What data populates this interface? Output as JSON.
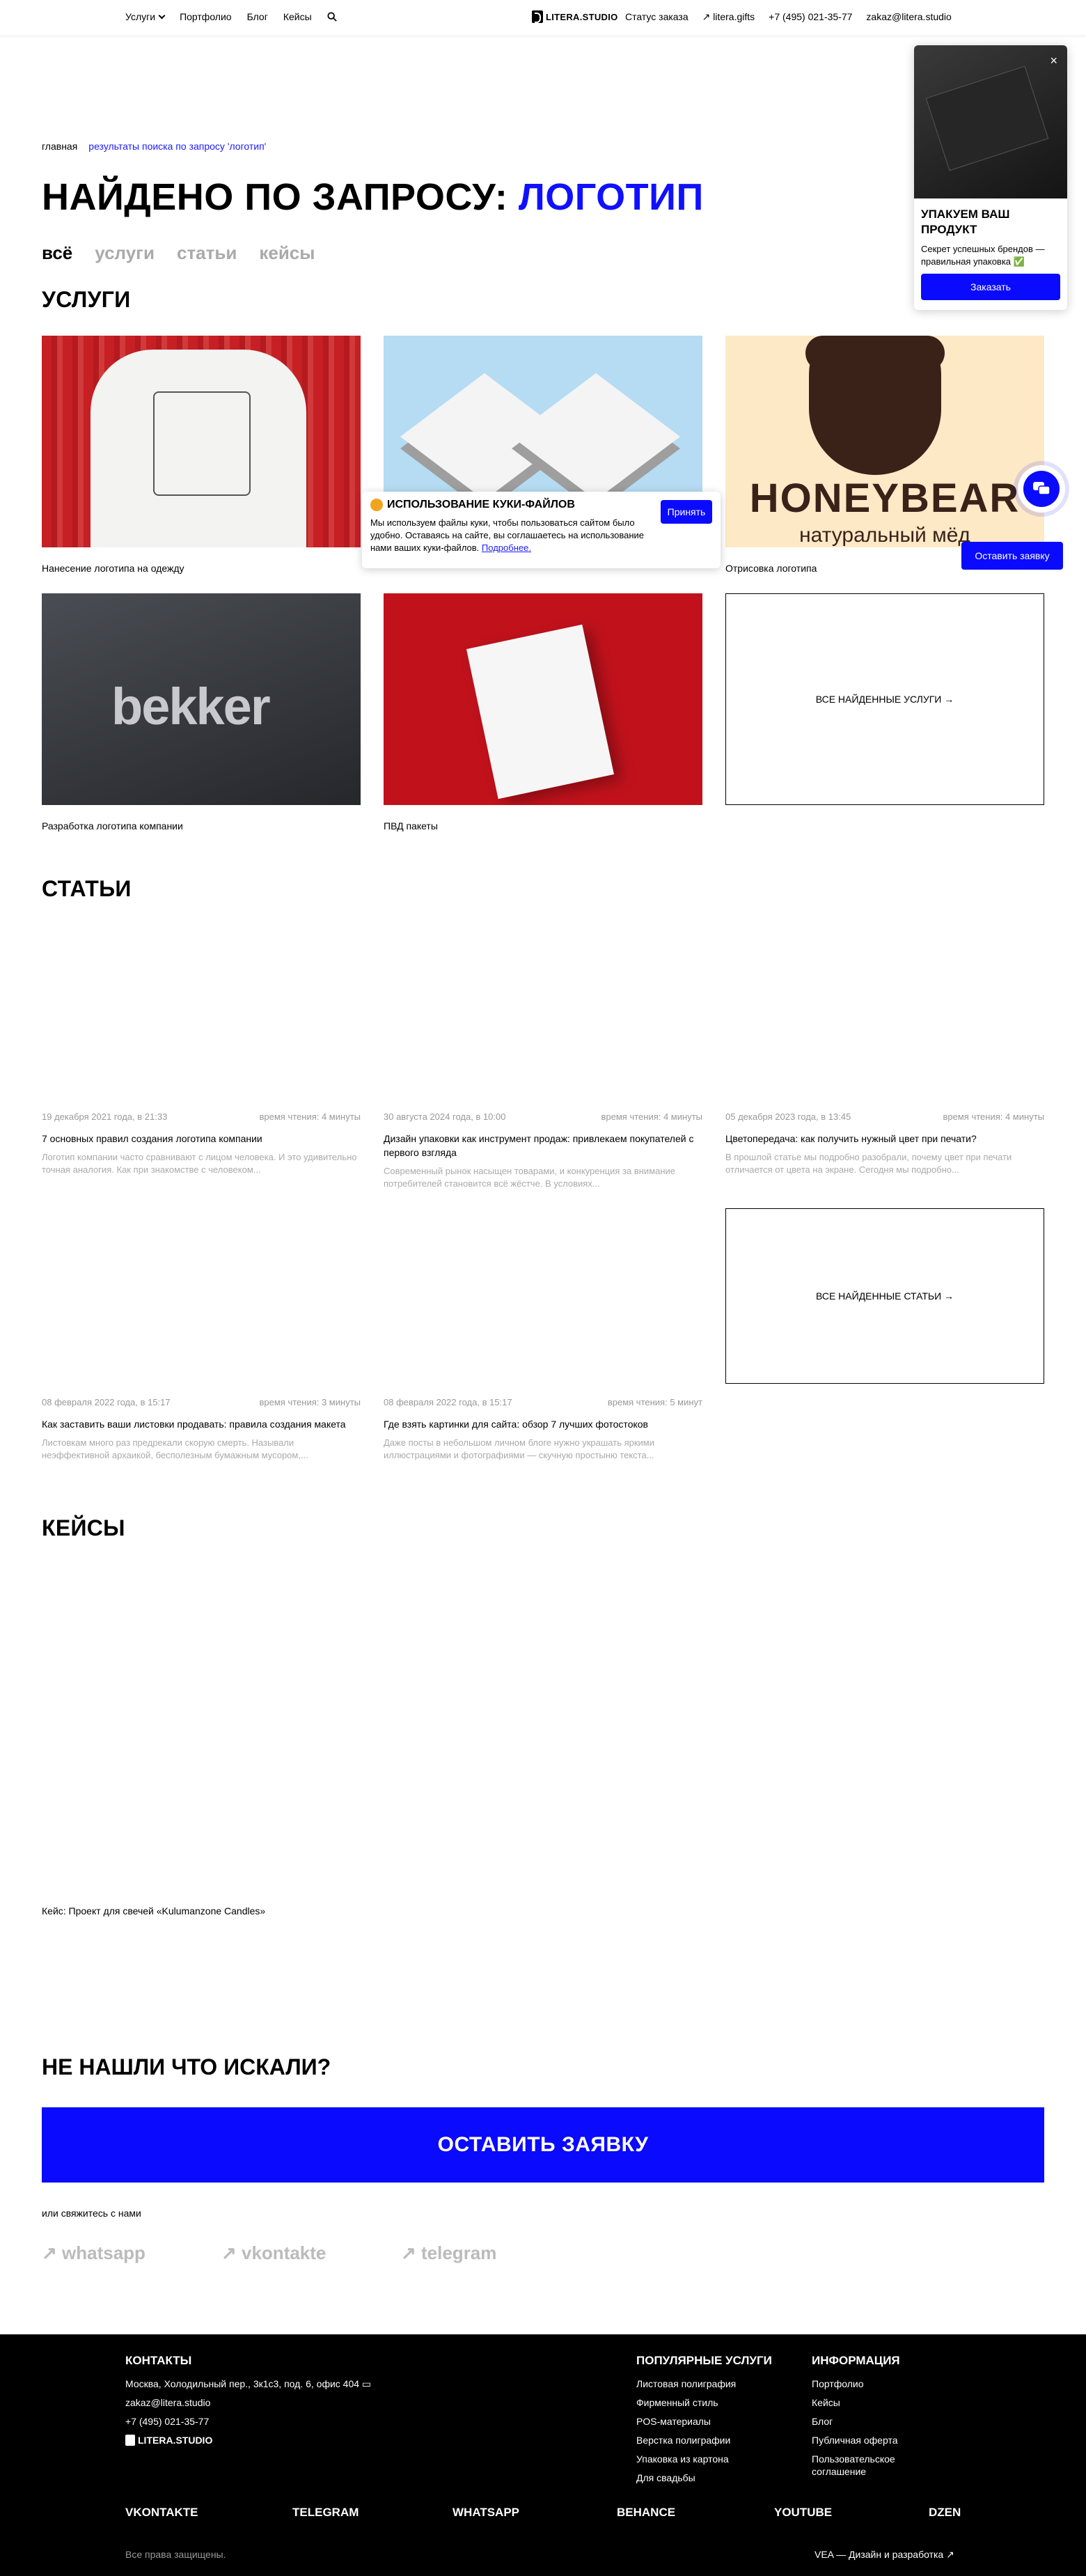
{
  "header": {
    "nav_left": [
      "Услуги",
      "Портфолио",
      "Блог",
      "Кейсы"
    ],
    "logo": "LITERA.STUDIO",
    "nav_right": [
      "Статус заказа",
      "↗ litera.gifts",
      "+7 (495) 021-35-77",
      "zakaz@litera.studio"
    ]
  },
  "breadcrumb": {
    "home": "главная",
    "current": "результаты поиска по запросу 'логотип'"
  },
  "title": {
    "prefix": "НАЙДЕНО ПО ЗАПРОСУ:",
    "query": "ЛОГОТИП"
  },
  "tabs": [
    "всё",
    "услуги",
    "статьи",
    "кейсы"
  ],
  "services": {
    "title": "УСЛУГИ",
    "cards": [
      {
        "caption": "Нанесение логотипа на одежду"
      },
      {
        "caption": ""
      },
      {
        "caption": "Отрисовка логотипа",
        "brand": "HONEYBEAR",
        "brand_sub": "натуральный мёд"
      },
      {
        "caption": "Разработка логотипа компании",
        "brand": "bekker"
      },
      {
        "caption": "ПВД пакеты"
      }
    ],
    "all_label": "ВСЕ НАЙДЕННЫЕ УСЛУГИ →"
  },
  "articles": {
    "title": "СТАТЬИ",
    "items": [
      {
        "date": "19 декабря 2021 года, в 21:33",
        "read": "время чтения: 4 минуты",
        "title": "7 основных правил создания логотипа компании",
        "excerpt": "Логотип компании часто сравнивают с лицом человека. И это удивительно точная аналогия. Как при знакомстве с человеком..."
      },
      {
        "date": "30 августа 2024 года, в 10:00",
        "read": "время чтения: 4 минуты",
        "title": "Дизайн упаковки как инструмент продаж: привлекаем покупателей с первого взгляда",
        "excerpt": "Современный рынок насыщен товарами, и конкуренция за внимание потребителей становится всё жёстче. В условиях..."
      },
      {
        "date": "05 декабря 2023 года, в 13:45",
        "read": "время чтения: 4 минуты",
        "title": "Цветопередача: как получить нужный цвет при печати?",
        "excerpt": "В прошлой статье мы подробно разобрали, почему цвет при печати отличается от цвета на экране. Сегодня мы подробно..."
      },
      {
        "date": "08 февраля 2022 года, в 15:17",
        "read": "время чтения: 3 минуты",
        "title": "Как заставить ваши листовки продавать: правила создания макета",
        "excerpt": "Листовкам много раз предрекали скорую смерть. Называли неэффективной архаикой, бесполезным бумажным мусором,..."
      },
      {
        "date": "08 февраля 2022 года, в 15:17",
        "read": "время чтения: 5 минут",
        "title": "Где взять картинки для сайта: обзор 7 лучших фотостоков",
        "excerpt": "Даже посты в небольшом личном блоге нужно украшать яркими иллюстрациями и фотографиями — скучную простыню текста..."
      }
    ],
    "all_label": "ВСЕ НАЙДЕННЫЕ СТАТЬИ →"
  },
  "cases": {
    "title": "КЕЙСЫ",
    "items": [
      {
        "caption": "Кейс: Проект для свечей «Kulumanzone Candles»"
      }
    ]
  },
  "not_found": {
    "title": "НЕ НАШЛИ ЧТО ИСКАЛИ?",
    "cta": "ОСТАВИТЬ ЗАЯВКУ",
    "contact_note": "или свяжитесь с нами",
    "socials": [
      "↗ whatsapp",
      "↗ vkontakte",
      "↗ telegram"
    ]
  },
  "footer": {
    "contacts": {
      "title": "КОНТАКТЫ",
      "address": "Москва, Холодильный пер., 3к1с3, под. 6, офис 404",
      "email": "zakaz@litera.studio",
      "phone": "+7 (495) 021-35-77",
      "logo": "LITERA.STUDIO"
    },
    "popular": {
      "title": "ПОПУЛЯРНЫЕ УСЛУГИ",
      "items": [
        "Листовая полиграфия",
        "Фирменный стиль",
        "POS-материалы",
        "Верстка полиграфии",
        "Упаковка из картона",
        "Для свадьбы"
      ]
    },
    "info": {
      "title": "ИНФОРМАЦИЯ",
      "items": [
        "Портфолио",
        "Кейсы",
        "Блог",
        "Публичная оферта",
        "Пользовательское соглашение"
      ]
    },
    "socials": [
      "VKONTAKTE",
      "TELEGRAM",
      "WHATSAPP",
      "BEHANCE",
      "YOUTUBE",
      "DZEN"
    ],
    "rights": "Все права защищены.",
    "dev": "VEA — Дизайн и разработка ↗"
  },
  "promo": {
    "title": "УПАКУЕМ ВАШ ПРОДУКТ",
    "text": "Секрет успешных брендов — правильная упаковка ✅",
    "button": "Заказать",
    "close": "×"
  },
  "cookie": {
    "title": "ИСПОЛЬЗОВАНИЕ КУКИ-ФАЙЛОВ",
    "text": "Мы используем файлы куки, чтобы пользоваться сайтом было удобно. Оставаясь на сайте, вы соглашаетесь на использование нами ваших куки-файлов.",
    "link": "Подробнее.",
    "button": "Принять"
  },
  "floating": {
    "leave_request": "Оставить заявку"
  },
  "colors": {
    "accent": "#0a0aff",
    "link": "#1b1bff",
    "muted": "#999999"
  }
}
